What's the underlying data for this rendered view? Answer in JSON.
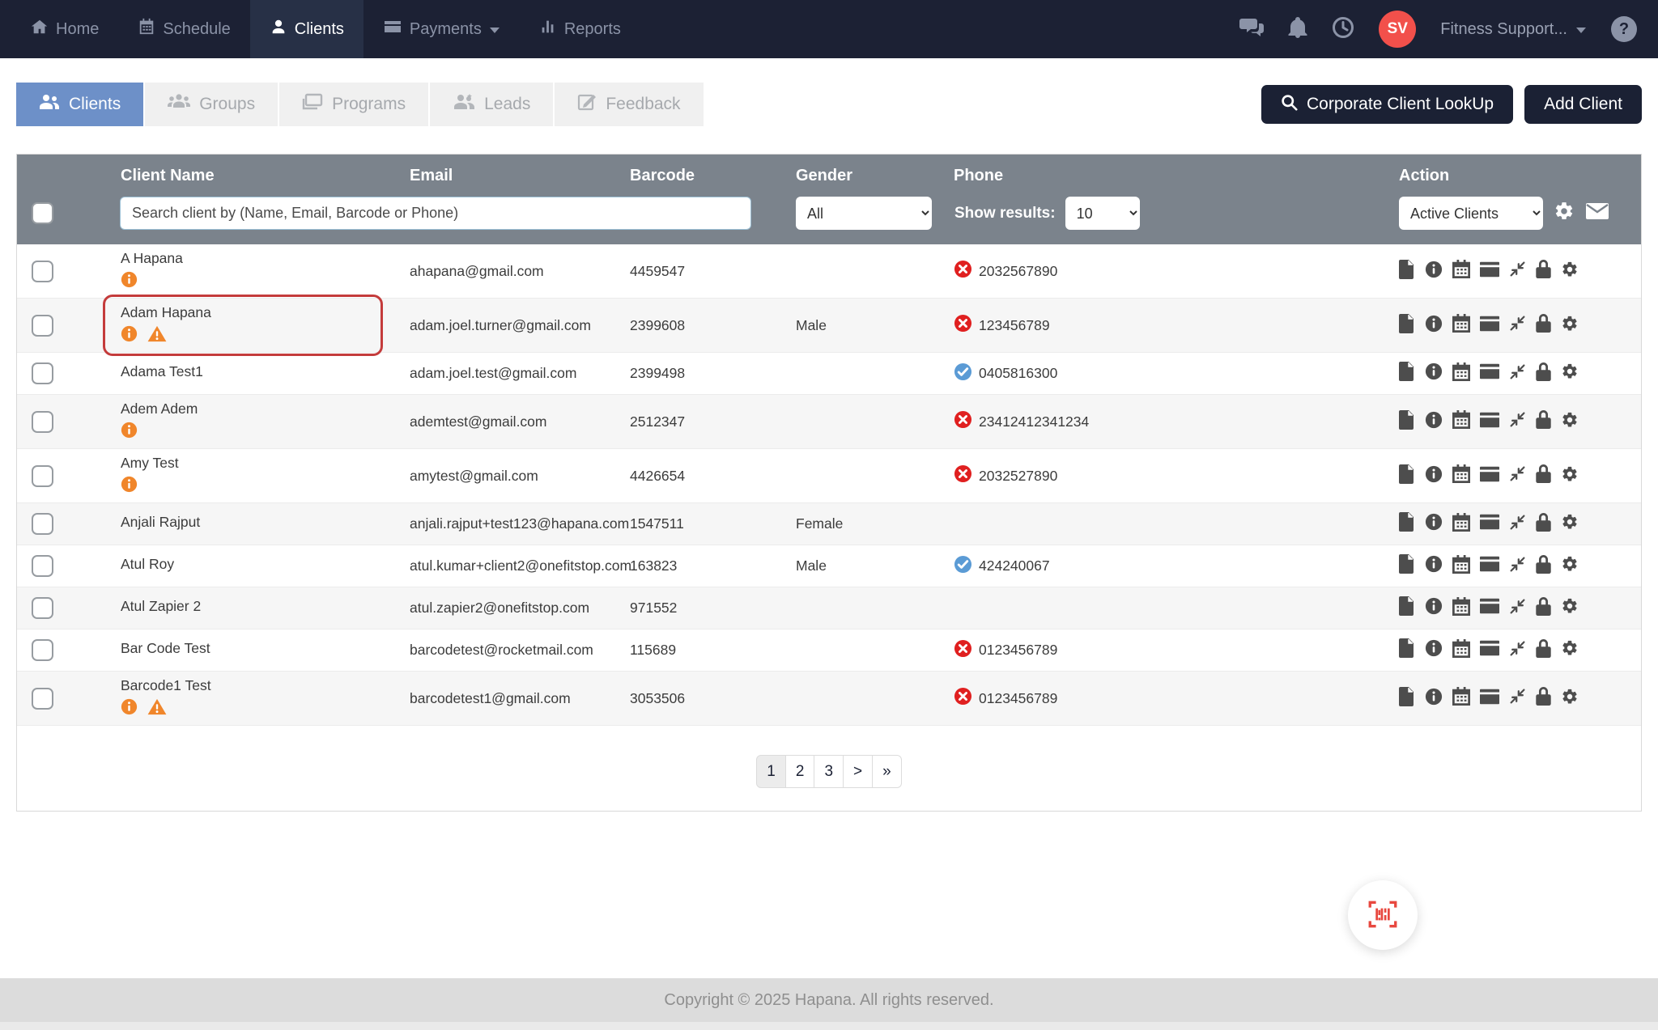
{
  "navbar": {
    "items": [
      {
        "label": "Home",
        "icon": "home-icon",
        "active": false
      },
      {
        "label": "Schedule",
        "icon": "calendar-icon",
        "active": false
      },
      {
        "label": "Clients",
        "icon": "user-icon",
        "active": true
      },
      {
        "label": "Payments",
        "icon": "credit-card-icon",
        "active": false,
        "has_caret": true
      },
      {
        "label": "Reports",
        "icon": "bar-chart-icon",
        "active": false
      }
    ],
    "right_icons": [
      "chat-icon",
      "bell-icon",
      "clock-icon"
    ],
    "user": {
      "initials": "SV",
      "name": "Fitness Support...",
      "help_glyph": "?"
    }
  },
  "tabs": [
    {
      "label": "Clients",
      "icon": "users-icon",
      "active": true
    },
    {
      "label": "Groups",
      "icon": "group-icon",
      "active": false
    },
    {
      "label": "Programs",
      "icon": "programs-icon",
      "active": false
    },
    {
      "label": "Leads",
      "icon": "leads-icon",
      "active": false
    },
    {
      "label": "Feedback",
      "icon": "feedback-icon",
      "active": false
    }
  ],
  "toolbar": {
    "corporate_lookup_label": "Corporate Client LookUp",
    "add_client_label": "Add Client"
  },
  "table": {
    "headers": {
      "name": "Client Name",
      "email": "Email",
      "barcode": "Barcode",
      "gender": "Gender",
      "phone": "Phone",
      "action": "Action"
    },
    "search_placeholder": "Search client by (Name, Email, Barcode or Phone)",
    "gender_filter_value": "All",
    "show_results_label": "Show results:",
    "show_results_value": "10",
    "action_filter_value": "Active Clients"
  },
  "clients": [
    {
      "name": "A Hapana",
      "info": true,
      "warning": false,
      "email": "ahapana@gmail.com",
      "barcode": "4459547",
      "gender": "",
      "phone": "2032567890",
      "phone_verified": false,
      "highlighted": false
    },
    {
      "name": "Adam Hapana",
      "info": true,
      "warning": true,
      "email": "adam.joel.turner@gmail.com",
      "barcode": "2399608",
      "gender": "Male",
      "phone": "123456789",
      "phone_verified": false,
      "highlighted": true
    },
    {
      "name": "Adama Test1",
      "info": false,
      "warning": false,
      "email": "adam.joel.test@gmail.com",
      "barcode": "2399498",
      "gender": "",
      "phone": "0405816300",
      "phone_verified": true,
      "highlighted": false
    },
    {
      "name": "Adem Adem",
      "info": true,
      "warning": false,
      "email": "ademtest@gmail.com",
      "barcode": "2512347",
      "gender": "",
      "phone": "23412412341234",
      "phone_verified": false,
      "highlighted": false
    },
    {
      "name": "Amy Test",
      "info": true,
      "warning": false,
      "email": "amytest@gmail.com",
      "barcode": "4426654",
      "gender": "",
      "phone": "2032527890",
      "phone_verified": false,
      "highlighted": false
    },
    {
      "name": "Anjali Rajput",
      "info": false,
      "warning": false,
      "email": "anjali.rajput+test123@hapana.com",
      "barcode": "1547511",
      "gender": "Female",
      "phone": "",
      "phone_verified": false,
      "highlighted": false
    },
    {
      "name": "Atul Roy",
      "info": false,
      "warning": false,
      "email": "atul.kumar+client2@onefitstop.com",
      "barcode": "163823",
      "gender": "Male",
      "phone": "424240067",
      "phone_verified": true,
      "highlighted": false
    },
    {
      "name": "Atul Zapier 2",
      "info": false,
      "warning": false,
      "email": "atul.zapier2@onefitstop.com",
      "barcode": "971552",
      "gender": "",
      "phone": "",
      "phone_verified": false,
      "highlighted": false
    },
    {
      "name": "Bar Code Test",
      "info": false,
      "warning": false,
      "email": "barcodetest@rocketmail.com",
      "barcode": "115689",
      "gender": "",
      "phone": "0123456789",
      "phone_verified": false,
      "highlighted": false
    },
    {
      "name": "Barcode1 Test",
      "info": true,
      "warning": true,
      "email": "barcodetest1@gmail.com",
      "barcode": "3053506",
      "gender": "",
      "phone": "0123456789",
      "phone_verified": false,
      "highlighted": false
    }
  ],
  "row_action_icons": [
    "document-icon",
    "info-circle-icon",
    "calendar-icon",
    "credit-card-icon",
    "compress-icon",
    "lock-icon",
    "gear-icon"
  ],
  "pagination": {
    "items": [
      {
        "label": "1",
        "active": true
      },
      {
        "label": "2",
        "active": false
      },
      {
        "label": "3",
        "active": false
      },
      {
        "label": ">",
        "active": false
      },
      {
        "label": "»",
        "active": false
      }
    ]
  },
  "fab": {
    "icon": "barcode-scan-icon"
  },
  "footer": {
    "copyright": "Copyright © 2025 Hapana. All rights reserved."
  },
  "colors": {
    "navbar_bg": "#1c2134",
    "active_tab_blue": "#6d90c8",
    "table_header_gray": "#7b838c",
    "avatar_red": "#f2504b",
    "unverified_red": "#e02020",
    "verified_blue": "#5b9bd5",
    "warning_orange": "#f0862b",
    "highlight_red": "#c43b3b",
    "fab_icon_red": "#e8483f"
  }
}
